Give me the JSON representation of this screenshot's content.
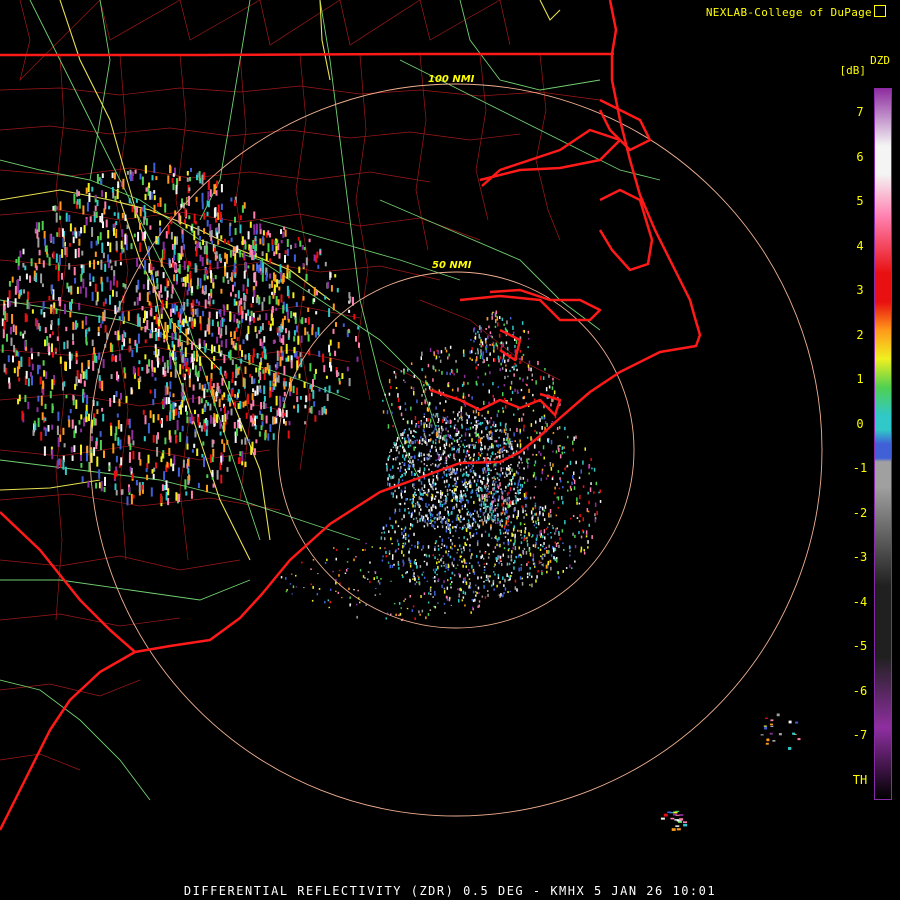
{
  "credit": "NEXLAB-College of DuPage",
  "credit_icon": "external-link-icon",
  "footer": "DIFFERENTIAL REFLECTIVITY (ZDR) 0.5 DEG - KMHX 5 JAN 26 10:01",
  "legend": {
    "product": "DZD",
    "unit": "[dB]",
    "ticks": [
      "7",
      "6",
      "5",
      "4",
      "3",
      "2",
      "1",
      "0",
      "-1",
      "-2",
      "-3",
      "-4",
      "-5",
      "-6",
      "-7",
      "TH"
    ],
    "colors": {
      "purple": "#8e2fa0",
      "white": "#f4f4f4",
      "pink": "#ff80b0",
      "red": "#e81010",
      "orange": "#ff9a1a",
      "yellow": "#f0f020",
      "green": "#50d050",
      "cyan": "#30c8c8",
      "blue": "#4060d8",
      "gray": "#a0a0a0",
      "dark": "#202020"
    }
  },
  "range_rings": {
    "inner_label": "50 NMI",
    "outer_label": "100 NMI"
  },
  "map_colors": {
    "state_border": "#ff1a1a",
    "county": "#b01818",
    "highway": "#80e080",
    "interstate": "#e8e050",
    "ring": "#f0b090"
  }
}
